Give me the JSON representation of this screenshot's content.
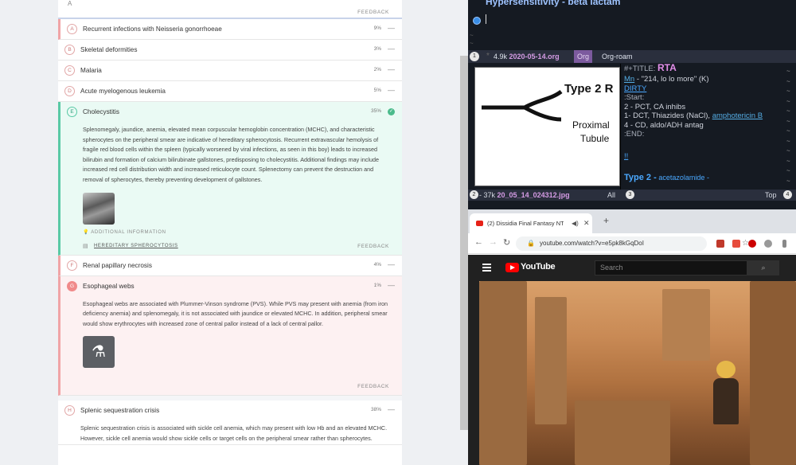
{
  "quiz": {
    "top_glyph": "A",
    "top_feedback": "FEEDBACK",
    "answers": [
      {
        "letter": "A",
        "text": "Recurrent infections with Neisseria gonorrhoeae",
        "pct": "9%",
        "toggle": "—"
      },
      {
        "letter": "B",
        "text": "Skeletal deformities",
        "pct": "3%",
        "toggle": "—"
      },
      {
        "letter": "C",
        "text": "Malaria",
        "pct": "2%",
        "toggle": "—"
      },
      {
        "letter": "D",
        "text": "Acute myelogenous leukemia",
        "pct": "5%",
        "toggle": "—"
      },
      {
        "letter": "E",
        "text": "Cholecystitis",
        "pct": "35%",
        "toggle": "✓"
      },
      {
        "letter": "F",
        "text": "Renal papillary necrosis",
        "pct": "4%",
        "toggle": "—"
      },
      {
        "letter": "G",
        "text": "Esophageal webs",
        "pct": "1%",
        "toggle": "—"
      },
      {
        "letter": "H",
        "text": "Splenic sequestration crisis",
        "pct": "38%",
        "toggle": "—"
      }
    ],
    "explanation_e": "Splenomegaly, jaundice, anemia, elevated mean corpuscular hemoglobin concentration (MCHC), and characteristic spherocytes on the peripheral smear are indicative of hereditary spherocytosis. Recurrent extravascular hemolysis of fragile red blood cells within the spleen (typically worsened by viral infections, as seen in this boy) leads to increased bilirubin and formation of calcium bilirubinate gallstones, predisposing to cholecystitis. Additional findings may include increased red cell distribution width and increased reticulocyte count. Splenectomy can prevent the destruction and removal of spherocytes, thereby preventing development of gallstones.",
    "additional_info": "ADDITIONAL INFORMATION",
    "reference_link": "HEREDITARY SPHEROCYTOSIS",
    "feedback": "FEEDBACK",
    "explanation_g": "Esophageal webs are associated with Plummer-Vinson syndrome (PVS). While PVS may present with anemia (from iron deficiency anemia) and splenomegaly, it is not associated with jaundice or elevated MCHC. In addition, peripheral smear would show erythrocytes with increased zone of central pallor instead of a lack of central pallor.",
    "explanation_h": "Splenic sequestration crisis is associated with sickle cell anemia, which may present with low Hb and an elevated MCHC. However, sickle cell anemia would show sickle cells or target cells on the peripheral smear rather than spherocytes."
  },
  "emacs": {
    "title": "Hypersensitivity - beta lactam",
    "modeline_top": {
      "num": "1",
      "star": "*",
      "size": "4.9k",
      "file": "2020-05-14.org",
      "mode": "Org",
      "minor": "Org-roam"
    },
    "image": {
      "heading": "Type 2 R",
      "label1": "Proximal",
      "label2": "Tubule"
    },
    "org_lines": {
      "title_kw": "#+TITLE:",
      "title": "RTA",
      "mn": "Mn",
      "mn_rest": "- \"214, lo lo more\" (K)",
      "dirty": "DIRTY",
      "start": ":Start:",
      "l2": "2 - PCT, CA inhibs",
      "l1a": "1- DCT, Thiazides (NaCl),",
      "l1b": "amphotericin B",
      "l4": "4 - CD, aldo/ADH antag",
      "end": ":END:",
      "bang": "!!",
      "h2": "Type 2 -",
      "h2b": "acetazolamide -"
    },
    "modeline_bottom": {
      "num": "2",
      "size": "- 37k",
      "file": "20_05_14_024312.jpg",
      "all": "All",
      "num3": "3",
      "top": "Top",
      "num4": "4"
    }
  },
  "browser": {
    "tab_title": "(2) Dissidia Final Fantasy NT",
    "url": "youtube.com/watch?v=e5pk8kGqDoI",
    "yt_word": "YouTube",
    "search_placeholder": "Search"
  }
}
